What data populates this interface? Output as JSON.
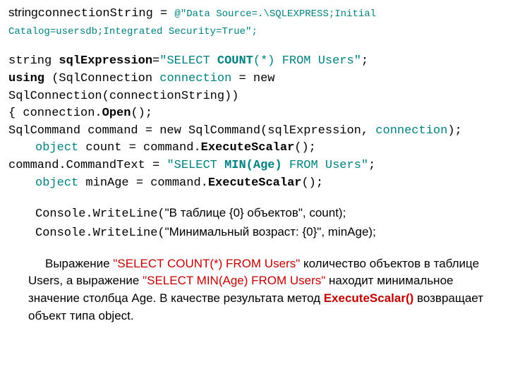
{
  "code": {
    "l1a": "string",
    "l1b": "connectionString = ",
    "l1c": "@\"Data Source=.\\SQLEXPRESS;Initial Catalog=usersdb;Integrated Security=True\";",
    "l3a": "string ",
    "l3b": "sqlExpression",
    "l3c": "=",
    "l3d": "\"SELECT ",
    "l3e": "COUNT",
    "l3f": "(*) FROM Users\"",
    "l3g": ";",
    "l4a": "using",
    "l4b": " (SqlConnection ",
    "l4c": "connection",
    "l4d": " = new SqlConnection(connectionString))",
    "l5a": "{   connection.",
    "l5b": "Open",
    "l5c": "();",
    "l6a": "SqlCommand command = new SqlCommand(sqlExpression, ",
    "l6b": "connection",
    "l6c": ");",
    "l7a": "object",
    "l7b": " count = command.",
    "l7c": "ExecuteScalar",
    "l7d": "();",
    "l8a": "command.CommandText = ",
    "l8b": "\"SELECT ",
    "l8c": "MIN(Age)",
    "l8d": " FROM Users\"",
    "l8e": ";",
    "l9a": "object",
    "l9b": " minAge = command.",
    "l9c": "ExecuteScalar",
    "l9d": "();",
    "l10a": "Console.WriteLine(",
    "l10b": "\"В таблице {0} объектов\", count);",
    "l11a": "Console.WriteLine(",
    "l11b": "\"Минимальный возраст: {0}\", minAge);"
  },
  "prose": {
    "t1": "Выражение ",
    "q1": "\"SELECT COUNT(*) FROM Users\"",
    "t2": " количество объектов в таблице Users, а выражение ",
    "q2": "\"SELECT MIN(Age) FROM Users\"",
    "t3": " находит минимальное значение столбца Age. В качестве результата метод ",
    "exec": "ExecuteScalar()",
    "t4": " возвращает объект типа object."
  }
}
